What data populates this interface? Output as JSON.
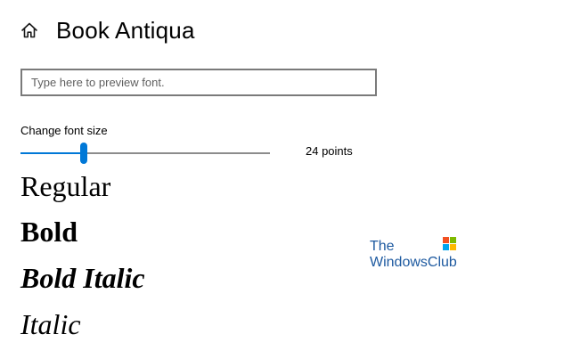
{
  "header": {
    "home_icon": "home-icon",
    "title": "Book Antiqua"
  },
  "preview": {
    "placeholder": "Type here to preview font.",
    "value": ""
  },
  "font_size": {
    "label": "Change font size",
    "value_text": "24 points",
    "slider_fraction": 0.255,
    "accent_color": "#0078d7",
    "track_color": "#8c8c8c"
  },
  "samples": [
    {
      "label": "Regular",
      "style": "regular"
    },
    {
      "label": "Bold",
      "style": "bold"
    },
    {
      "label": "Bold Italic",
      "style": "bold-italic"
    },
    {
      "label": "Italic",
      "style": "italic"
    }
  ],
  "watermark": {
    "line1": "The",
    "line2": "WindowsClub",
    "text_color": "#1e5aa0",
    "logo_colors": [
      "#f25022",
      "#7fba00",
      "#00a4ef",
      "#ffb900"
    ]
  }
}
